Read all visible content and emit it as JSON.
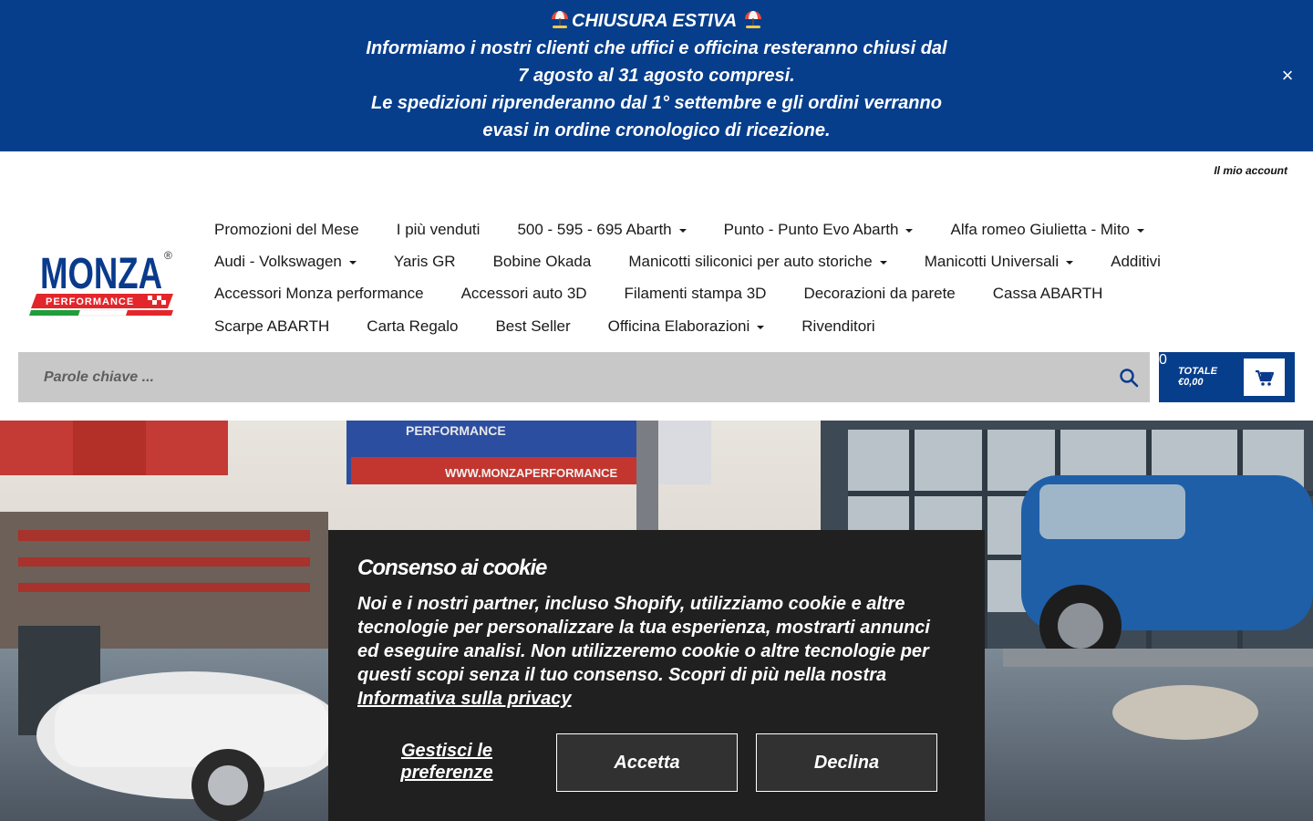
{
  "announcement": {
    "title": "CHIUSURA ESTIVA",
    "line1": "Informiamo i nostri clienti che uffici e officina resteranno chiusi dal",
    "line2": "7 agosto al 31 agosto compresi.",
    "line3": "Le spedizioni riprenderanno dal 1° settembre e gli ordini verranno",
    "line4": "evasi in ordine cronologico di ricezione.",
    "close_label": "×"
  },
  "header": {
    "account_label": "Il mio account",
    "logo_text": "MONZA",
    "logo_subtext": "PERFORMANCE",
    "logo_mark": "®"
  },
  "nav": {
    "row1": [
      {
        "label": "Promozioni del Mese",
        "dropdown": false
      },
      {
        "label": "I più venduti",
        "dropdown": false
      },
      {
        "label": "500 - 595 - 695 Abarth",
        "dropdown": true
      },
      {
        "label": "Punto - Punto Evo Abarth",
        "dropdown": true
      },
      {
        "label": "Alfa romeo Giulietta - Mito",
        "dropdown": true
      }
    ],
    "row2": [
      {
        "label": "Audi - Volkswagen",
        "dropdown": true
      },
      {
        "label": "Yaris GR",
        "dropdown": false
      },
      {
        "label": "Bobine Okada",
        "dropdown": false
      },
      {
        "label": "Manicotti siliconici per auto storiche",
        "dropdown": true
      },
      {
        "label": "Manicotti Universali",
        "dropdown": true
      },
      {
        "label": "Additivi",
        "dropdown": false
      }
    ],
    "row3": [
      {
        "label": "Accessori Monza performance",
        "dropdown": false
      },
      {
        "label": "Accessori auto 3D",
        "dropdown": false
      },
      {
        "label": "Filamenti stampa 3D",
        "dropdown": false
      },
      {
        "label": "Decorazioni da parete",
        "dropdown": false
      },
      {
        "label": "Cassa ABARTH",
        "dropdown": false
      }
    ],
    "row4": [
      {
        "label": "Scarpe ABARTH",
        "dropdown": false
      },
      {
        "label": "Carta Regalo",
        "dropdown": false
      },
      {
        "label": "Best Seller",
        "dropdown": false
      },
      {
        "label": "Officina Elaborazioni",
        "dropdown": true
      },
      {
        "label": "Rivenditori",
        "dropdown": false
      }
    ]
  },
  "search": {
    "placeholder": "Parole chiave ...",
    "value": ""
  },
  "cart": {
    "total_label": "TOTALE",
    "total_value": "€0,00",
    "count": "0"
  },
  "cookie": {
    "title": "Consenso ai cookie",
    "body": "Noi e i nostri partner, incluso Shopify, utilizziamo cookie e altre tecnologie per personalizzare la tua esperienza, mostrarti annunci ed eseguire analisi. Non utilizzeremo cookie o altre tecnologie per questi scopi senza il tuo consenso. Scopri di più nella nostra",
    "privacy_link": "Informativa sulla privacy",
    "manage_label": "Gestisci le preferenze",
    "accept_label": "Accetta",
    "decline_label": "Declina"
  },
  "hero_banner_text": "WWW.MONZAPERFORMANCE",
  "hero_banner_brand": "PERFORMANCE",
  "colors": {
    "brand_blue": "#063e8c",
    "cookie_bg": "#202020",
    "search_bg": "#c8c8c8"
  }
}
